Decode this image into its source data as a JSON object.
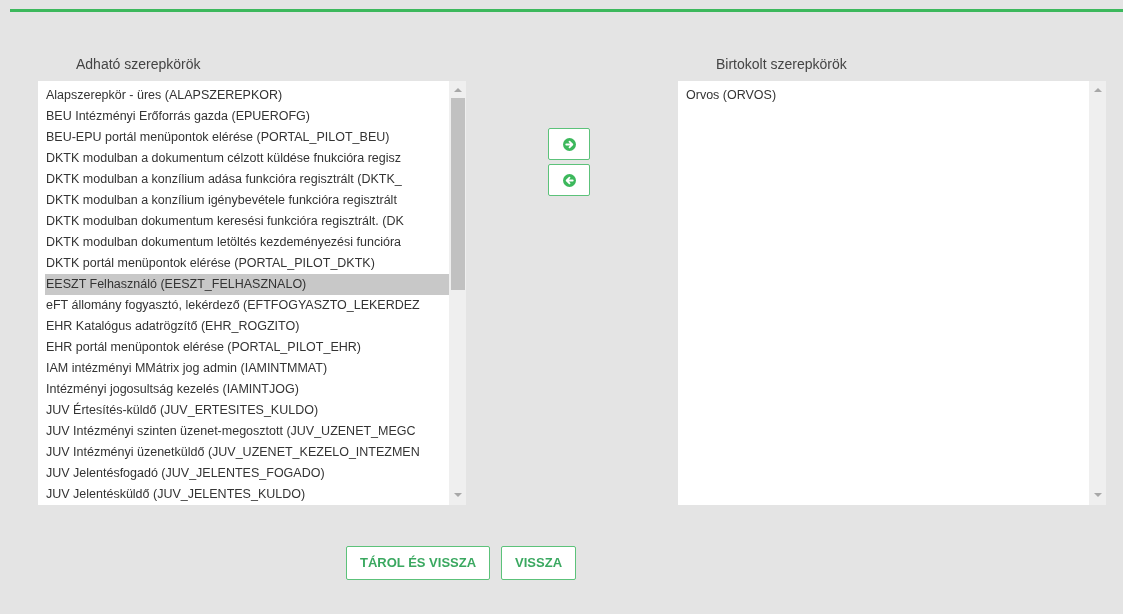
{
  "available": {
    "label": "Adható szerepkörök",
    "items": [
      {
        "text": "Alapszerepkör - üres (ALAPSZEREPKOR)",
        "selected": false
      },
      {
        "text": "BEU Intézményi Erőforrás gazda (EPUEROFG)",
        "selected": false
      },
      {
        "text": "BEU-EPU portál menüpontok elérése (PORTAL_PILOT_BEU)",
        "selected": false
      },
      {
        "text": "DKTK modulban a dokumentum célzott küldése fnukcióra regisz",
        "selected": false
      },
      {
        "text": "DKTK modulban a konzílium adása funkcióra regisztrált (DKTK_",
        "selected": false
      },
      {
        "text": "DKTK modulban a konzílium igénybevétele funkcióra regisztrált",
        "selected": false
      },
      {
        "text": "DKTK modulban dokumentum keresési funkcióra regisztrált. (DK",
        "selected": false
      },
      {
        "text": "DKTK modulban dokumentum letöltés kezdeményezési funcióra",
        "selected": false
      },
      {
        "text": "DKTK portál menüpontok elérése (PORTAL_PILOT_DKTK)",
        "selected": false
      },
      {
        "text": "EESZT Felhasználó (EESZT_FELHASZNALO)",
        "selected": true
      },
      {
        "text": "eFT állomány fogyasztó, lekérdező (EFTFOGYASZTO_LEKERDEZ",
        "selected": false
      },
      {
        "text": "EHR Katalógus adatrögzítő (EHR_ROGZITO)",
        "selected": false
      },
      {
        "text": "EHR portál menüpontok elérése (PORTAL_PILOT_EHR)",
        "selected": false
      },
      {
        "text": "IAM intézményi MMátrix jog admin (IAMINTMMAT)",
        "selected": false
      },
      {
        "text": "Intézményi jogosultság kezelés (IAMINTJOG)",
        "selected": false
      },
      {
        "text": "JUV Értesítés-küldő (JUV_ERTESITES_KULDO)",
        "selected": false
      },
      {
        "text": "JUV Intézményi szinten üzenet-megosztott (JUV_UZENET_MEGC",
        "selected": false
      },
      {
        "text": "JUV Intézményi üzenetküldő (JUV_UZENET_KEZELO_INTEZMEN",
        "selected": false
      },
      {
        "text": "JUV Jelentésfogadó (JUV_JELENTES_FOGADO)",
        "selected": false
      },
      {
        "text": "JUV Jelentésküldő (JUV_JELENTES_KULDO)",
        "selected": false
      }
    ]
  },
  "owned": {
    "label": "Birtokolt szerepkörök",
    "items": [
      {
        "text": "Orvos (ORVOS)",
        "selected": false
      }
    ]
  },
  "buttons": [
    "TÁROL ÉS VISSZA",
    "VISSZA"
  ]
}
